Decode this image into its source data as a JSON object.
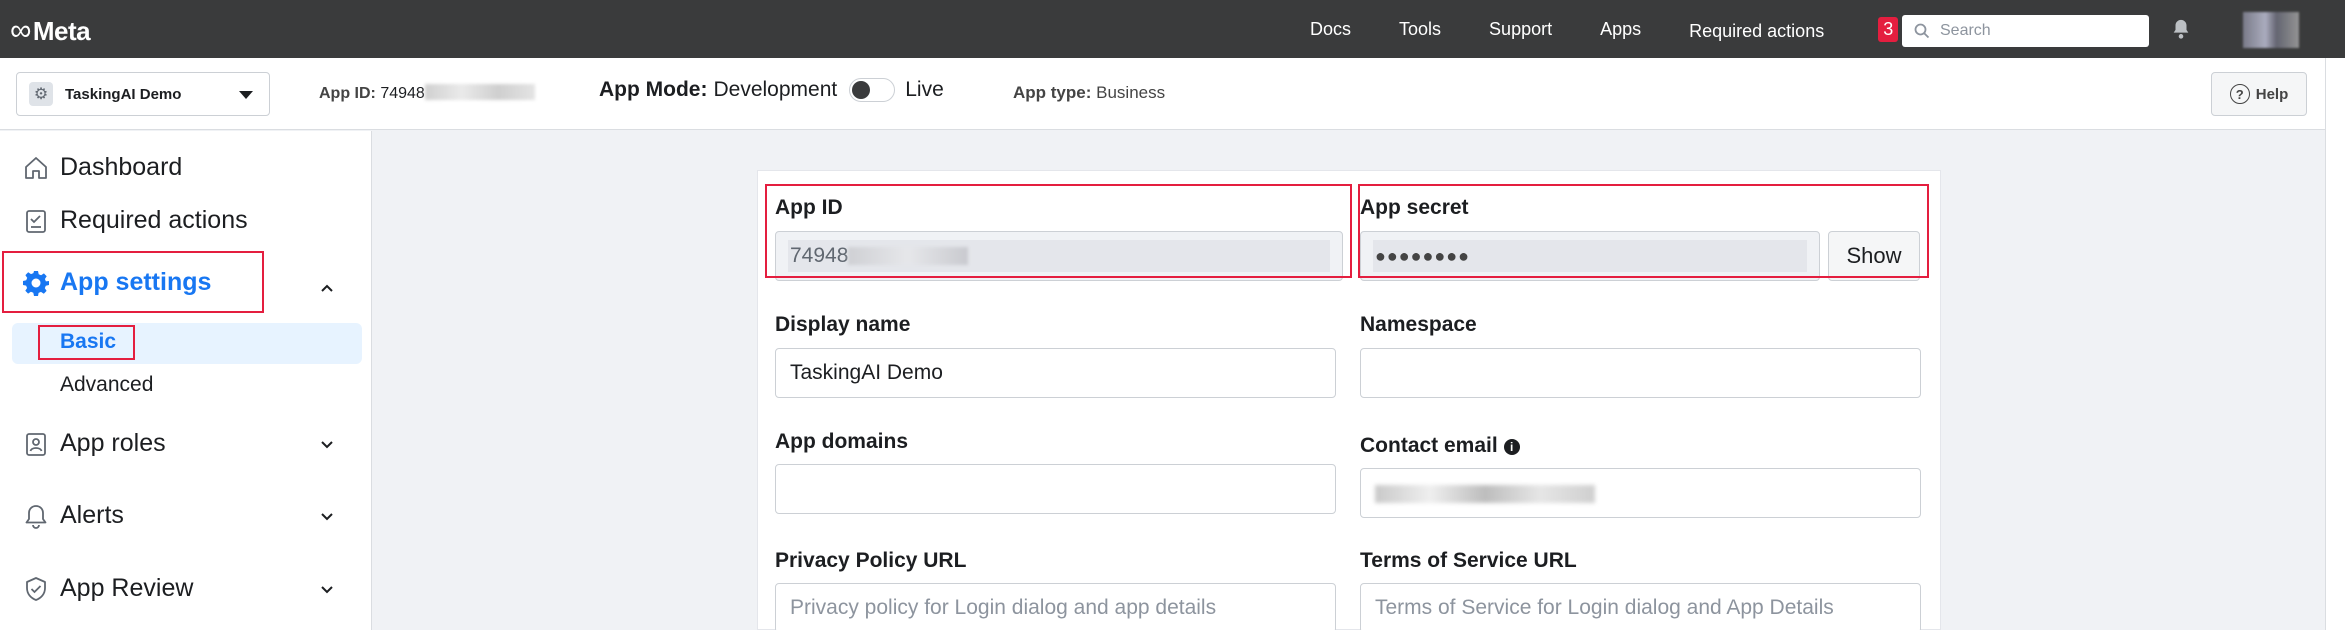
{
  "topnav": {
    "logo": "Meta",
    "links": [
      "Docs",
      "Tools",
      "Support",
      "Apps",
      "Required actions"
    ],
    "required_count": "3",
    "search_placeholder": "Search"
  },
  "subbar": {
    "app_name": "TaskingAI Demo",
    "app_id_label": "App ID:",
    "app_id_value": "74948",
    "app_mode_label": "App Mode:",
    "mode_development": "Development",
    "mode_live": "Live",
    "app_type_label": "App type:",
    "app_type_value": "Business",
    "help": "Help"
  },
  "sidebar": {
    "dashboard": "Dashboard",
    "required_actions": "Required actions",
    "app_settings": "App settings",
    "basic": "Basic",
    "advanced": "Advanced",
    "app_roles": "App roles",
    "alerts": "Alerts",
    "app_review": "App Review"
  },
  "form": {
    "app_id_label": "App ID",
    "app_id_value": "74948",
    "app_secret_label": "App secret",
    "app_secret_value": "●●●●●●●●",
    "show": "Show",
    "display_name_label": "Display name",
    "display_name_value": "TaskingAI Demo",
    "namespace_label": "Namespace",
    "app_domains_label": "App domains",
    "contact_email_label": "Contact email",
    "privacy_label": "Privacy Policy URL",
    "privacy_placeholder": "Privacy policy for Login dialog and app details",
    "tos_label": "Terms of Service URL",
    "tos_placeholder": "Terms of Service for Login dialog and App Details"
  },
  "colors": {
    "accent": "#1877f2",
    "highlight_red": "#e41e3f",
    "topnav_bg": "#3a3b3c"
  }
}
